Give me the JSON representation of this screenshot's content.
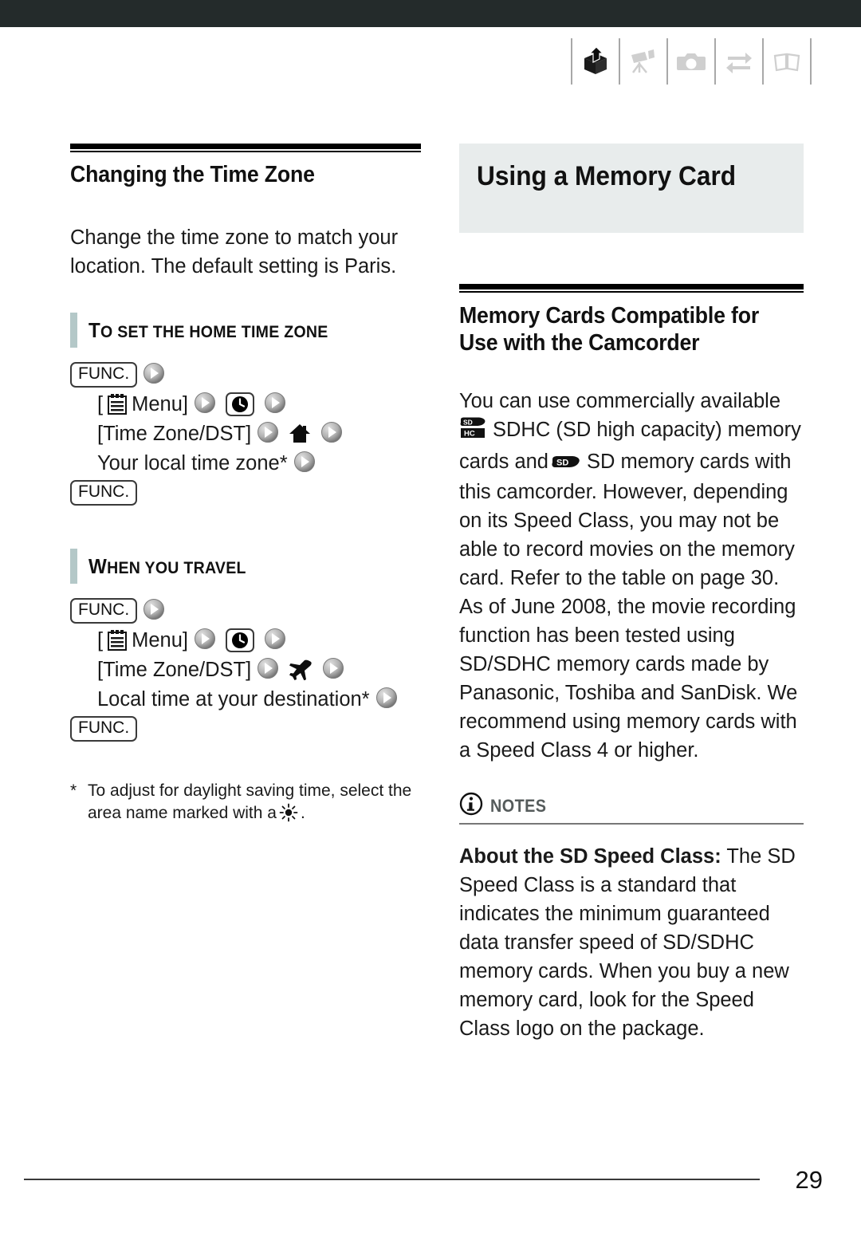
{
  "header": {
    "icons": [
      {
        "name": "package-arrow-icon",
        "state": "active"
      },
      {
        "name": "camcorder-icon",
        "state": "inactive"
      },
      {
        "name": "photo-camera-icon",
        "state": "inactive"
      },
      {
        "name": "exchange-arrows-icon",
        "state": "inactive"
      },
      {
        "name": "open-book-icon",
        "state": "inactive"
      }
    ]
  },
  "left_column": {
    "section_title": "Changing the Time Zone",
    "intro": "Change the time zone to match your location. The default setting is Paris.",
    "subsections": [
      {
        "heading_first": "T",
        "heading_rest": "O SET THE HOME TIME ZONE",
        "heading_full": "TO SET THE HOME TIME ZONE",
        "steps": [
          {
            "func": "FUNC.",
            "arrow_after": true
          },
          {
            "bracket_open": "[",
            "menu_icon": "menu-list-icon",
            "label": " Menu]",
            "arrow1": true,
            "boxed_icon": "clock-icon",
            "arrow2": true
          },
          {
            "label": "[Time Zone/DST]",
            "arrow1": true,
            "icon": "house-icon",
            "arrow2": true
          },
          {
            "label": "Your local time zone*",
            "arrow1": true
          },
          {
            "func": "FUNC."
          }
        ]
      },
      {
        "heading_first": "W",
        "heading_rest": "HEN YOU TRAVEL",
        "heading_full": "WHEN YOU TRAVEL",
        "steps": [
          {
            "func": "FUNC.",
            "arrow_after": true
          },
          {
            "bracket_open": "[",
            "menu_icon": "menu-list-icon",
            "label": " Menu]",
            "arrow1": true,
            "boxed_icon": "clock-icon",
            "arrow2": true
          },
          {
            "label": "[Time Zone/DST]",
            "arrow1": true,
            "icon": "airplane-icon",
            "arrow2": true
          },
          {
            "label": "Local time at your destination*",
            "arrow1": true
          },
          {
            "func": "FUNC."
          }
        ]
      }
    ],
    "footnote_marker": "*",
    "footnote_text_before": "To adjust for daylight saving time, select the area name marked with a",
    "footnote_icon": "sun-icon",
    "footnote_text_after": "."
  },
  "right_column": {
    "page_title": "Using a Memory Card",
    "section_title": "Memory Cards Compatible for Use with the Camcorder",
    "paragraph_1_part1": "You can use commercially available",
    "paragraph_1_icon1": "sdhc-logo",
    "paragraph_1_part2": "SDHC (SD high capacity) memory cards and",
    "paragraph_1_icon2": "sd-logo",
    "paragraph_1_part3": "SD memory cards with this camcorder. However, depending on its Speed Class, you may not be able to record movies on the memory card. Refer to the table on page 30.",
    "paragraph_2": "As of June 2008, the movie recording function has been tested using SD/SDHC memory cards made by Panasonic, Toshiba and SanDisk. We recommend using memory cards with a Speed Class 4 or higher.",
    "notes": {
      "icon": "info-circle-icon",
      "title": "NOTES",
      "body_bold": "About the SD Speed Class:",
      "body_text": " The SD Speed Class is a standard that indicates the minimum guaranteed data transfer speed of SD/SDHC memory cards. When you buy a new memory card, look for the Speed Class logo on the package."
    }
  },
  "footer": {
    "page_number": "29"
  },
  "colors": {
    "top_bar": "#242b2b",
    "title_box_bg": "#e8ecec",
    "accent_bar": "#b4c8c8",
    "notes_gray": "#555b5b",
    "inactive_icon": "#cfcfcf"
  }
}
